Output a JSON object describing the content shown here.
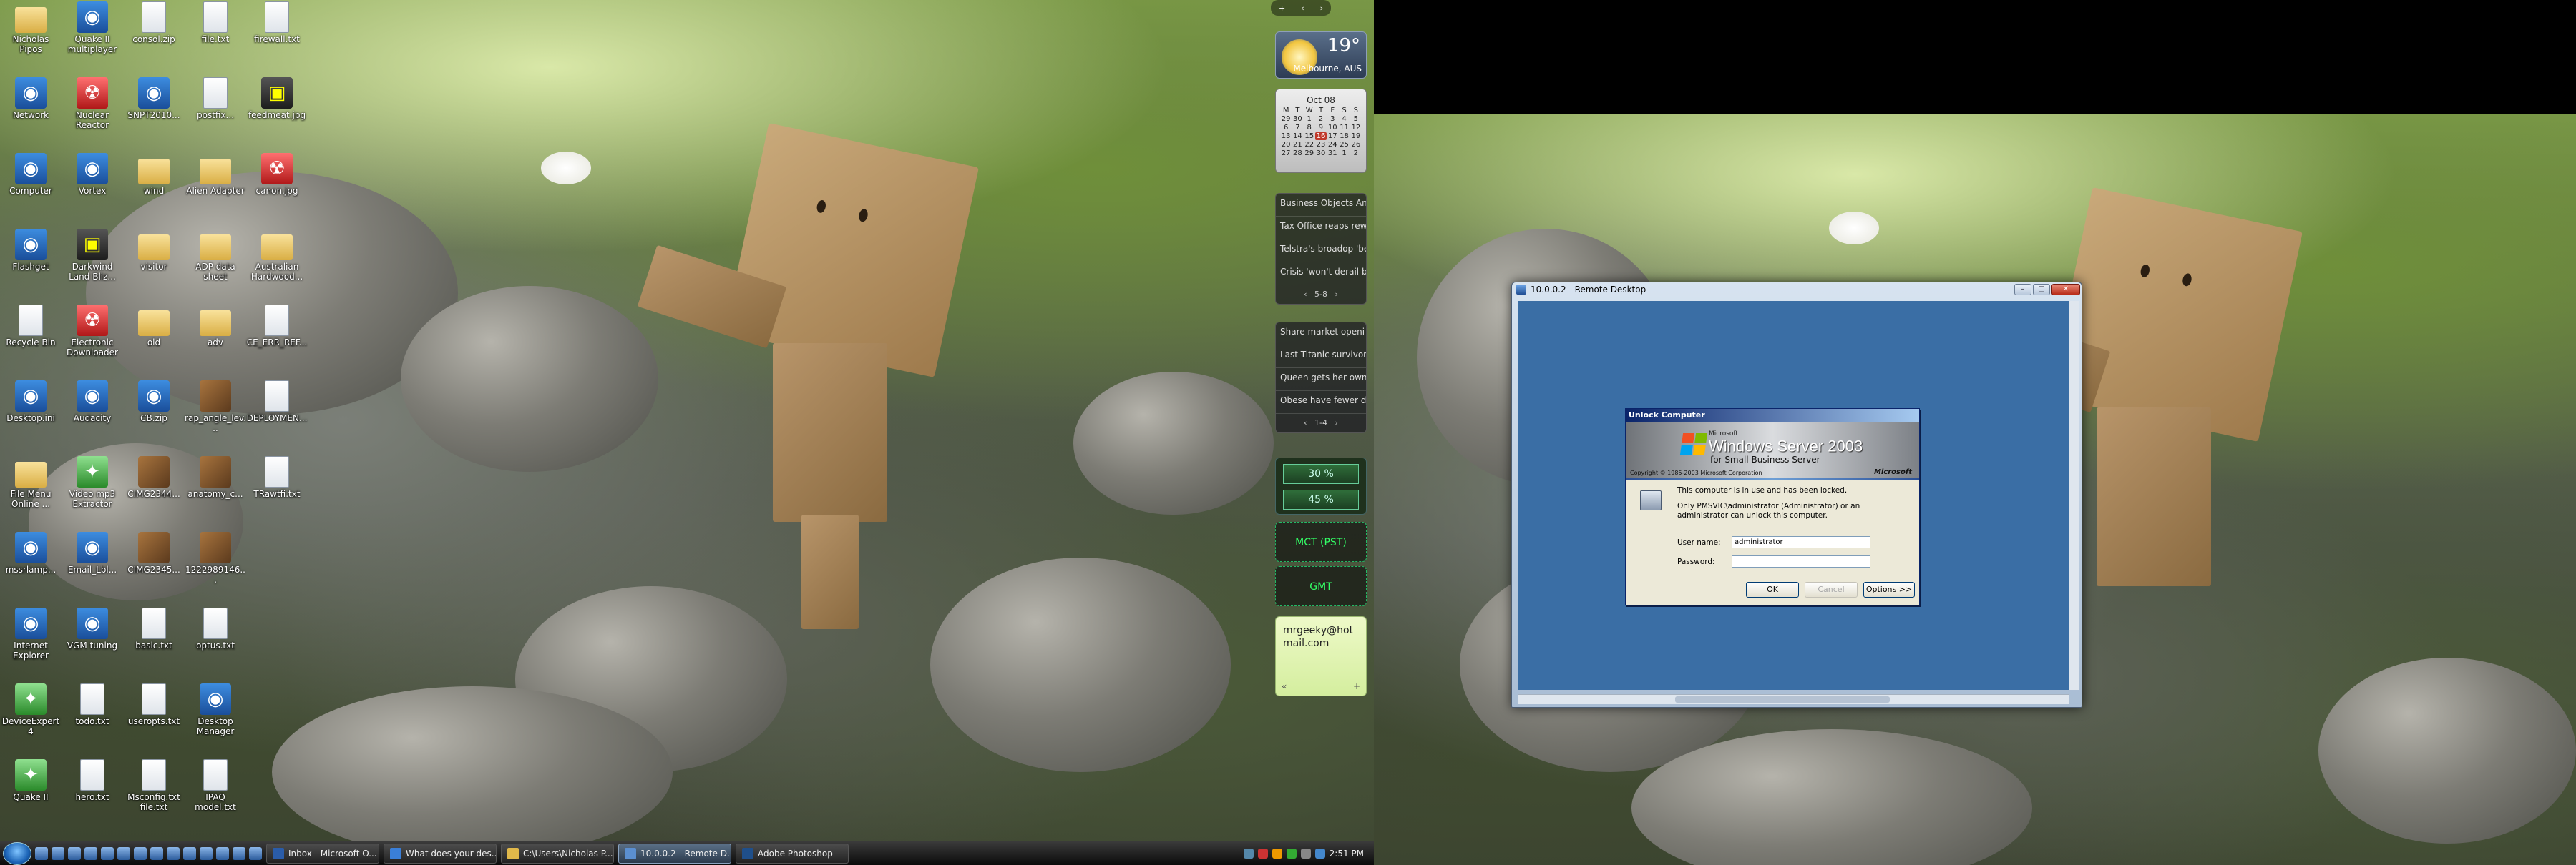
{
  "desktop_icons": [
    {
      "label": "Nicholas Pipos",
      "kind": "folder"
    },
    {
      "label": "Quake II multiplayer",
      "kind": "app"
    },
    {
      "label": "consol.zip",
      "kind": "file"
    },
    {
      "label": "file.txt",
      "kind": "file"
    },
    {
      "label": "firewall.txt",
      "kind": "file"
    },
    {
      "label": "Network",
      "kind": "app"
    },
    {
      "label": "Nuclear Reactor",
      "kind": "red"
    },
    {
      "label": "SNPT2010...",
      "kind": "app"
    },
    {
      "label": "postfix...",
      "kind": "file"
    },
    {
      "label": "feedmeat.jpg",
      "kind": "dark"
    },
    {
      "label": "Computer",
      "kind": "app"
    },
    {
      "label": "Vortex",
      "kind": "app"
    },
    {
      "label": "wind",
      "kind": "folder"
    },
    {
      "label": "Alien Adapter",
      "kind": "folder"
    },
    {
      "label": "canon.jpg",
      "kind": "red"
    },
    {
      "label": "Flashget",
      "kind": "app"
    },
    {
      "label": "Darkwind Land Bliz...",
      "kind": "dark"
    },
    {
      "label": "visitor",
      "kind": "folder"
    },
    {
      "label": "ADP data sheet",
      "kind": "folder"
    },
    {
      "label": "Australian Hardwood...",
      "kind": "folder"
    },
    {
      "label": "Recycle Bin",
      "kind": "file"
    },
    {
      "label": "Electronic Downloader",
      "kind": "red"
    },
    {
      "label": "old",
      "kind": "folder"
    },
    {
      "label": "adv",
      "kind": "folder"
    },
    {
      "label": "CE_ERR_REF...",
      "kind": "file"
    },
    {
      "label": "Desktop.ini",
      "kind": "app"
    },
    {
      "label": "Audacity",
      "kind": "app"
    },
    {
      "label": "CB.zip",
      "kind": "app"
    },
    {
      "label": "rap_angle_lev...",
      "kind": "pic"
    },
    {
      "label": "DEPLOYMEN...",
      "kind": "file"
    },
    {
      "label": "File Menu Online ...",
      "kind": "folder"
    },
    {
      "label": "Video mp3 Extractor",
      "kind": "green"
    },
    {
      "label": "CIMG2344...",
      "kind": "pic"
    },
    {
      "label": "anatomy_c...",
      "kind": "pic"
    },
    {
      "label": "TRawtfi.txt",
      "kind": "file"
    },
    {
      "label": "mssrlamp...",
      "kind": "app"
    },
    {
      "label": "Email_Lbl...",
      "kind": "app"
    },
    {
      "label": "CIMG2345...",
      "kind": "pic"
    },
    {
      "label": "1222989146...",
      "kind": "pic"
    },
    {
      "label": "",
      "kind": "none"
    },
    {
      "label": "Internet Explorer",
      "kind": "app"
    },
    {
      "label": "VGM tuning",
      "kind": "app"
    },
    {
      "label": "basic.txt",
      "kind": "file"
    },
    {
      "label": "optus.txt",
      "kind": "file"
    },
    {
      "label": "",
      "kind": "none"
    },
    {
      "label": "DeviceExpert 4",
      "kind": "green"
    },
    {
      "label": "todo.txt",
      "kind": "file"
    },
    {
      "label": "useropts.txt",
      "kind": "file"
    },
    {
      "label": "Desktop Manager",
      "kind": "app"
    },
    {
      "label": "",
      "kind": "none"
    },
    {
      "label": "Quake II",
      "kind": "green"
    },
    {
      "label": "hero.txt",
      "kind": "file"
    },
    {
      "label": "Msconfig.txt file.txt",
      "kind": "file"
    },
    {
      "label": "IPAQ model.txt",
      "kind": "file"
    }
  ],
  "sidebar": {
    "weather": {
      "temp": "19°",
      "location": "Melbourne, AUS"
    },
    "calendar": {
      "month": "Oct 08",
      "weekdays": [
        "M",
        "T",
        "W",
        "T",
        "F",
        "S",
        "S"
      ],
      "days": [
        "29",
        "30",
        "1",
        "2",
        "3",
        "4",
        "5",
        "6",
        "7",
        "8",
        "9",
        "10",
        "11",
        "12",
        "13",
        "14",
        "15",
        "16",
        "17",
        "18",
        "19",
        "20",
        "21",
        "22",
        "23",
        "24",
        "25",
        "26",
        "27",
        "28",
        "29",
        "30",
        "31",
        "1",
        "2"
      ],
      "today": "16"
    },
    "feed1": {
      "items": [
        "Business Objects Ann...",
        "Tax Office reaps rew...",
        "Telstra's broadop 'be...",
        "Crisis 'won't derail br..."
      ],
      "nav": "5-8"
    },
    "feed2": {
      "items": [
        "Share market openi ...",
        "Last Titanic survivor ...",
        "Queen gets her own ...",
        "Obese have fewer d..."
      ],
      "nav": "1-4"
    },
    "meter": {
      "cpu": "30 %",
      "mem": "45 %"
    },
    "clock1": "MCT (PST)",
    "clock2": "GMT",
    "note": {
      "text": "mrgeeky@hotmail.com",
      "prev": "«",
      "add": "+"
    }
  },
  "taskbar": {
    "tasks": [
      {
        "label": "Inbox - Microsoft O..."
      },
      {
        "label": "What does your des..."
      },
      {
        "label": "C:\\Users\\Nicholas P..."
      },
      {
        "label": "10.0.0.2 - Remote D..."
      },
      {
        "label": "Adobe Photoshop"
      }
    ],
    "time": "2:51 PM"
  },
  "rdp": {
    "title": "10.0.0.2 - Remote Desktop",
    "minimize": "–",
    "maximize": "□",
    "close": "✕"
  },
  "unlock": {
    "title": "Unlock Computer",
    "microsoft": "Microsoft",
    "product": "Windows Server 2003",
    "product_sup": "",
    "edition": "for Small Business Server",
    "copyright": "Copyright © 1985-2003  Microsoft Corporation",
    "brand": "Microsoft",
    "message1": "This computer is in use and has been locked.",
    "message2": "Only PMSVIC\\administrator (Administrator) or an administrator can unlock this computer.",
    "username_label": "User name:",
    "username_value": "administrator",
    "password_label": "Password:",
    "password_value": "",
    "ok": "OK",
    "cancel": "Cancel",
    "options": "Options >>"
  }
}
